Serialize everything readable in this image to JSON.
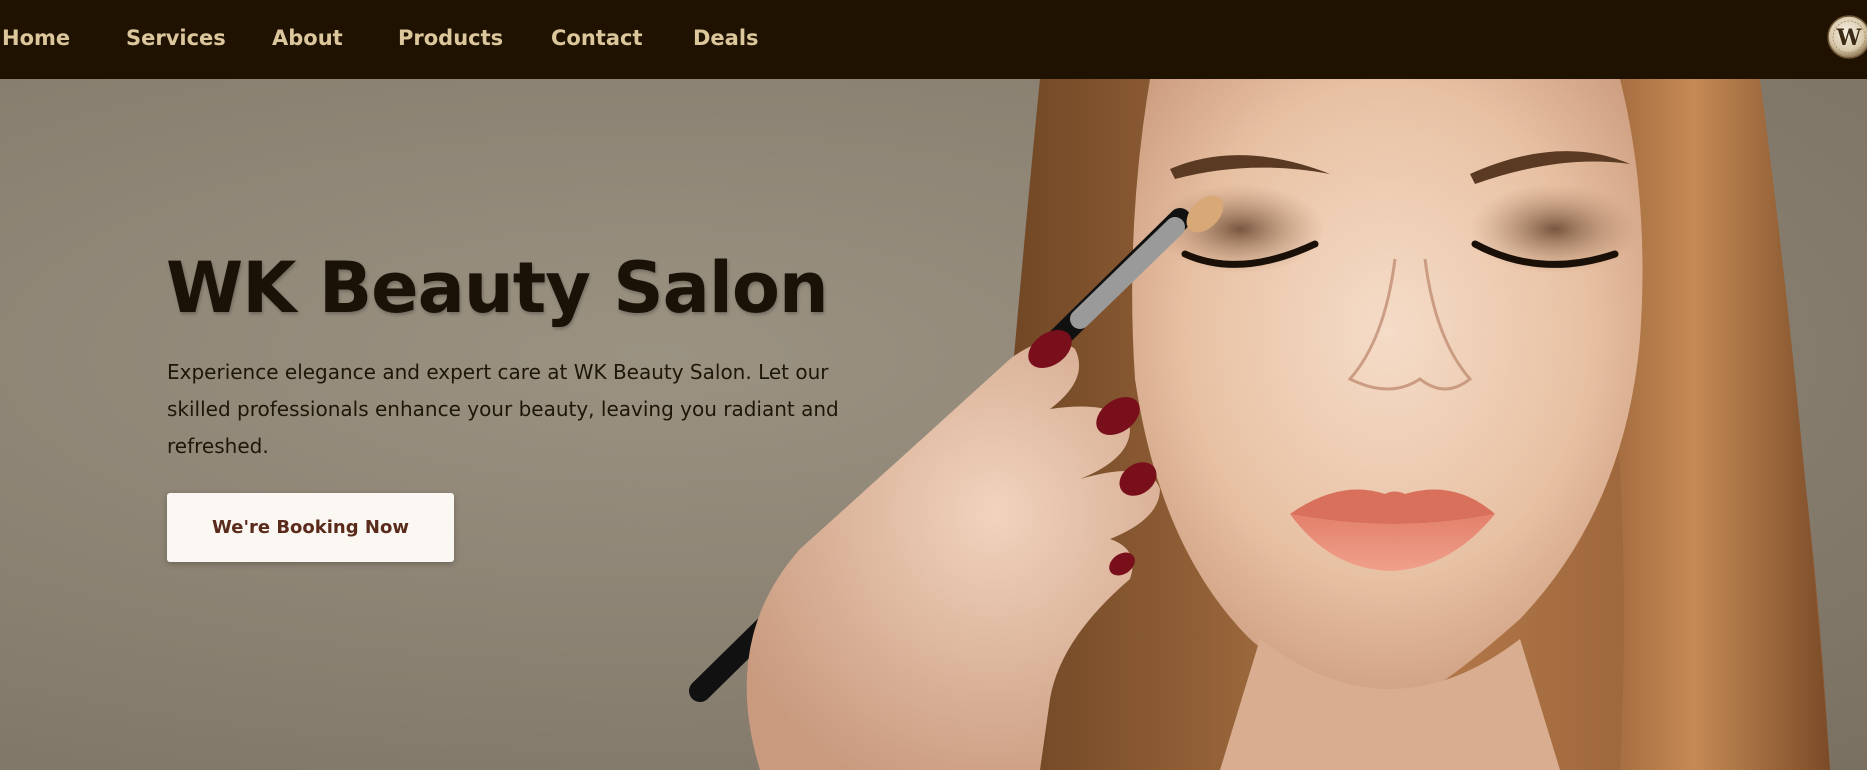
{
  "nav": {
    "items": [
      {
        "label": "Home"
      },
      {
        "label": "Services"
      },
      {
        "label": "About"
      },
      {
        "label": "Products"
      },
      {
        "label": "Contact"
      },
      {
        "label": "Deals"
      }
    ],
    "logo": {
      "monogram": "W",
      "icon": "salon-logo-icon"
    }
  },
  "hero": {
    "title": "WK Beauty Salon",
    "description": "Experience elegance and expert care at WK Beauty Salon. Let our skilled professionals enhance your beauty, leaving you radiant and refreshed.",
    "cta_label": "We're Booking Now",
    "image": "woman-makeup-eyeshadow-photo"
  },
  "colors": {
    "nav_background": "#1f1200",
    "nav_text": "#dcc79c",
    "hero_background": "#8c8172",
    "title_text": "#1a1206",
    "cta_background": "#fbf7f3",
    "cta_text": "#5a2a1a"
  }
}
